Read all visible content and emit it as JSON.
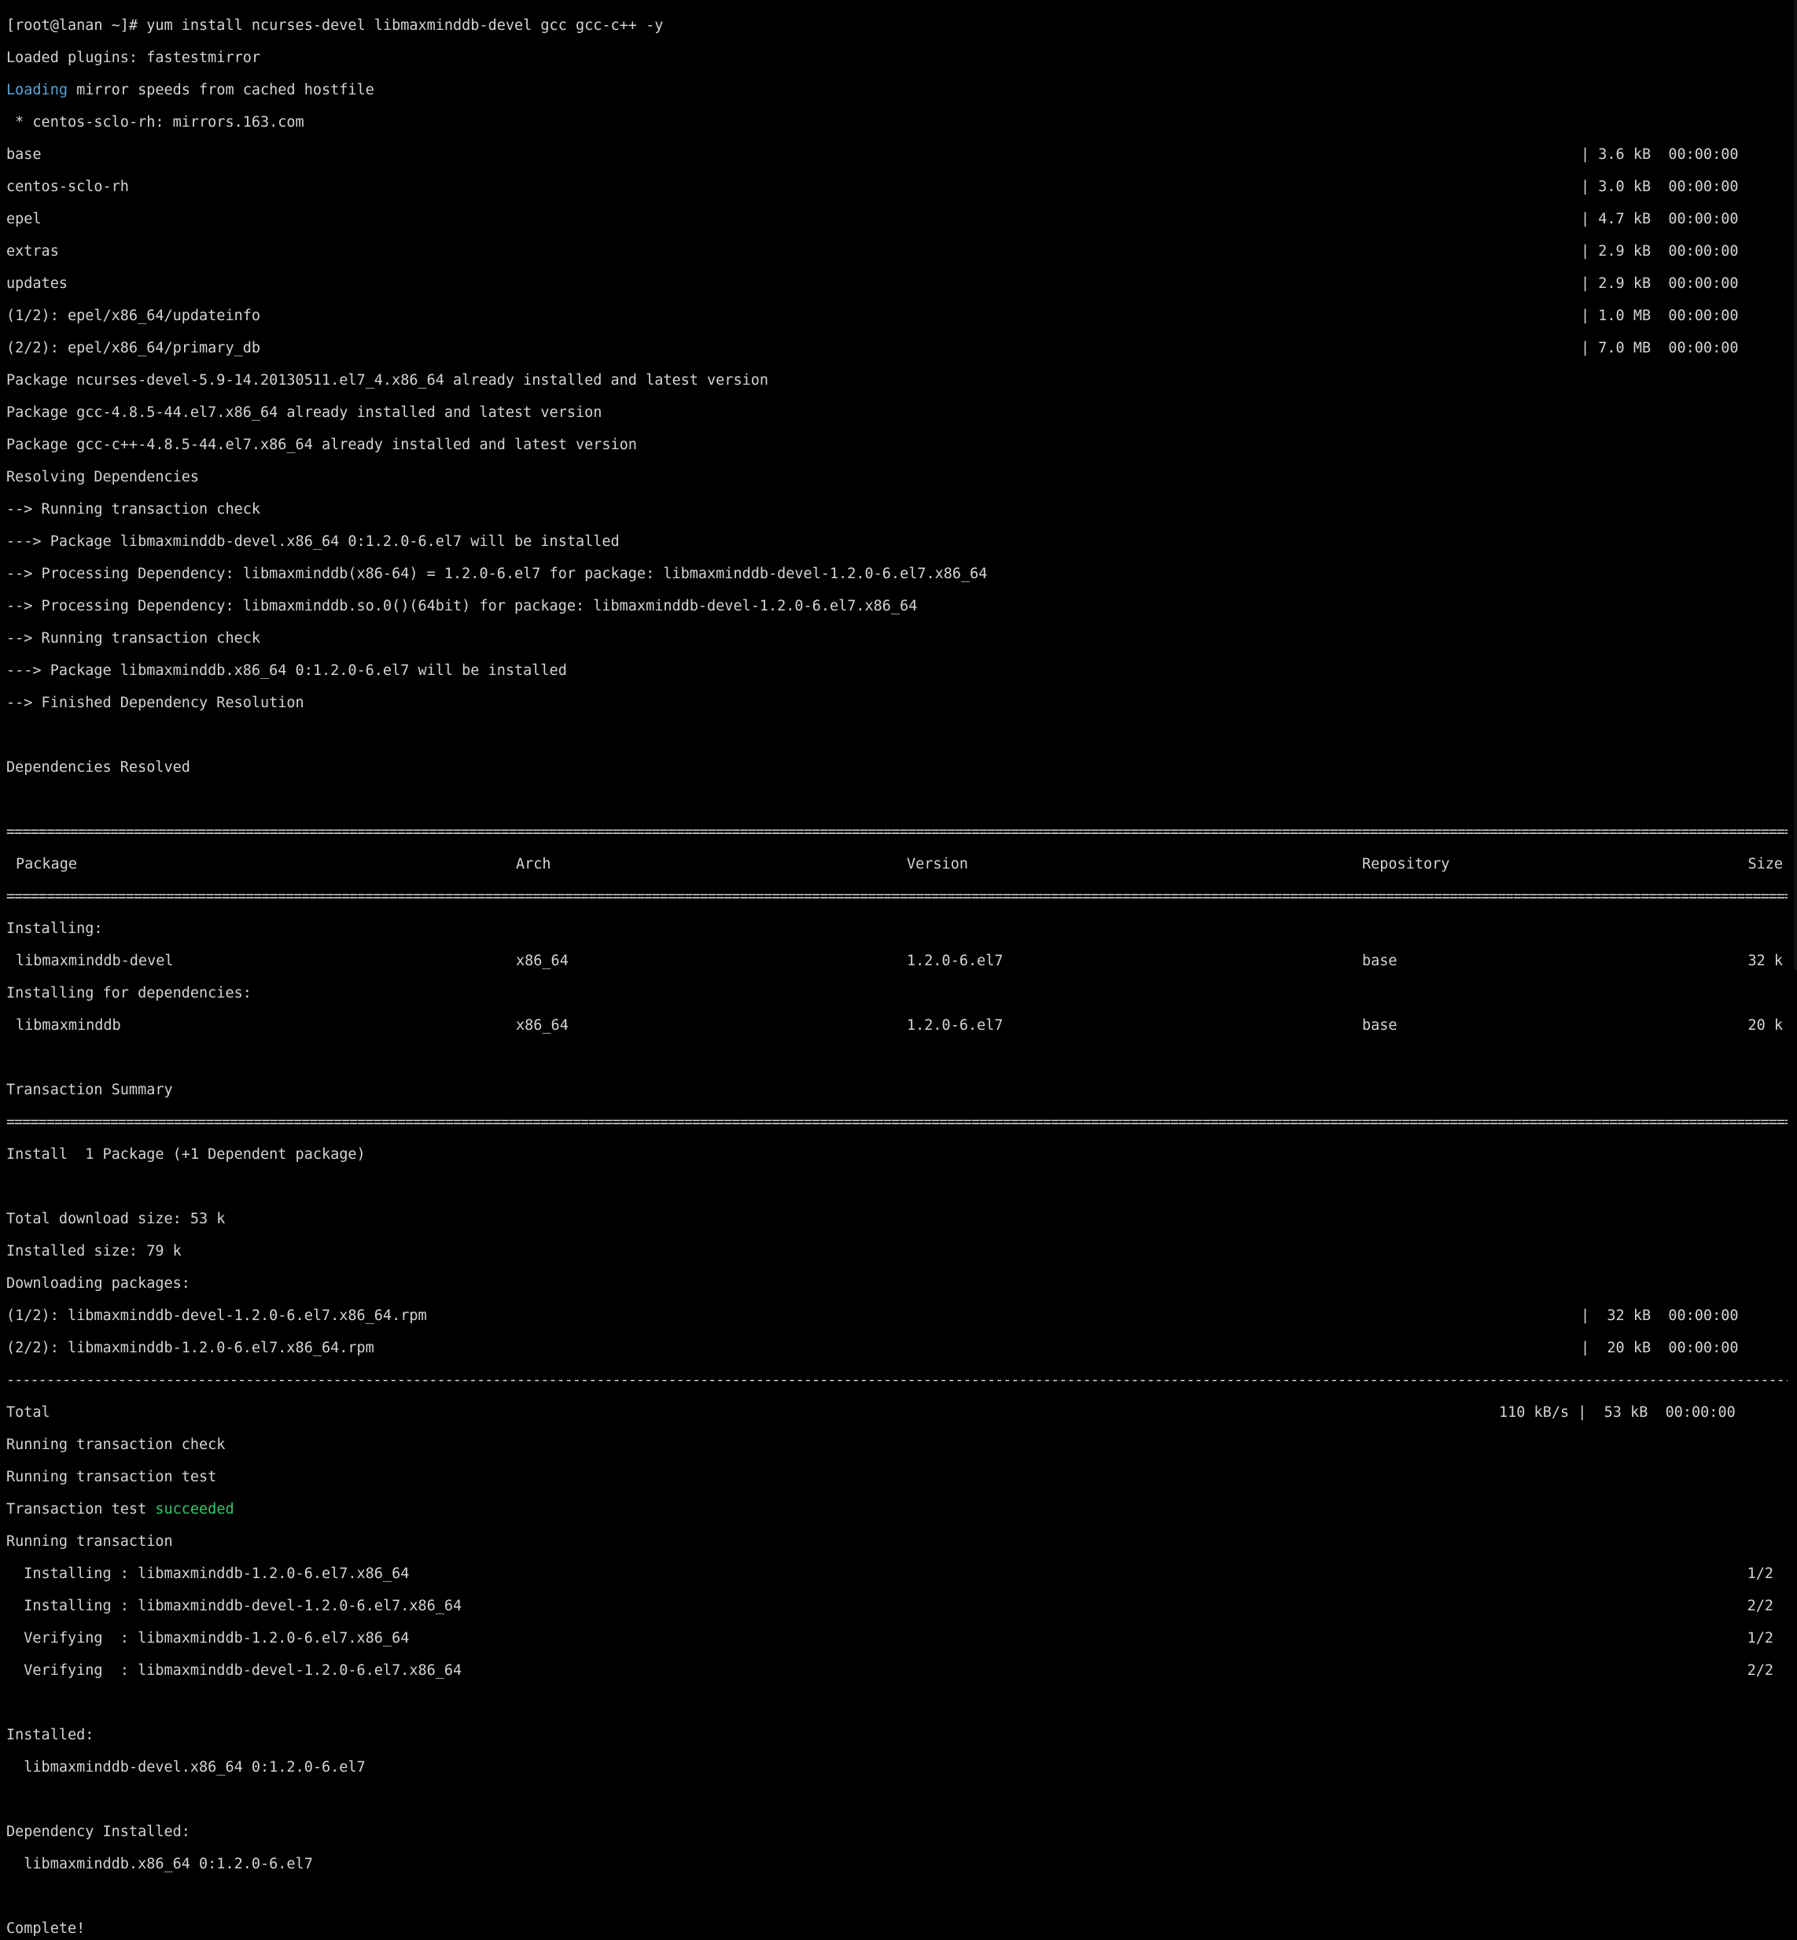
{
  "prompt": "[root@lanan ~]# yum install ncurses-devel libmaxminddb-devel gcc gcc-c++ -y",
  "plugins": "Loaded plugins: fastestmirror",
  "mirror": {
    "word": "Loading",
    "rest": " mirror speeds from cached hostfile"
  },
  "mirror_host": " * centos-sclo-rh: mirrors.163.com",
  "repos": [
    {
      "name": "base",
      "stat": "| 3.6 kB  00:00:00"
    },
    {
      "name": "centos-sclo-rh",
      "stat": "| 3.0 kB  00:00:00"
    },
    {
      "name": "epel",
      "stat": "| 4.7 kB  00:00:00"
    },
    {
      "name": "extras",
      "stat": "| 2.9 kB  00:00:00"
    },
    {
      "name": "updates",
      "stat": "| 2.9 kB  00:00:00"
    },
    {
      "name": "(1/2): epel/x86_64/updateinfo",
      "stat": "| 1.0 MB  00:00:00"
    },
    {
      "name": "(2/2): epel/x86_64/primary_db",
      "stat": "| 7.0 MB  00:00:00"
    }
  ],
  "pre_lines": [
    "Package ncurses-devel-5.9-14.20130511.el7_4.x86_64 already installed and latest version",
    "Package gcc-4.8.5-44.el7.x86_64 already installed and latest version",
    "Package gcc-c++-4.8.5-44.el7.x86_64 already installed and latest version",
    "Resolving Dependencies",
    "--> Running transaction check",
    "---> Package libmaxminddb-devel.x86_64 0:1.2.0-6.el7 will be installed",
    "--> Processing Dependency: libmaxminddb(x86-64) = 1.2.0-6.el7 for package: libmaxminddb-devel-1.2.0-6.el7.x86_64",
    "--> Processing Dependency: libmaxminddb.so.0()(64bit) for package: libmaxminddb-devel-1.2.0-6.el7.x86_64",
    "--> Running transaction check",
    "---> Package libmaxminddb.x86_64 0:1.2.0-6.el7 will be installed",
    "--> Finished Dependency Resolution"
  ],
  "deps_resolved": "Dependencies Resolved",
  "separator_eq": "=============================================================================================================================================================================================================================================================",
  "separator_dash": "---------------------------------------------------------------------------------------------------------------------------------------------------------------------------------------------------------------------------------------------------------------",
  "table_header": {
    "package": "Package",
    "arch": "Arch",
    "version": "Version",
    "repository": "Repository",
    "size": "Size"
  },
  "installing_label": "Installing:",
  "row1": {
    "package": "libmaxminddb-devel",
    "arch": "x86_64",
    "version": "1.2.0-6.el7",
    "repository": "base",
    "size": "32 k"
  },
  "installing_deps_label": "Installing for dependencies:",
  "row2": {
    "package": "libmaxminddb",
    "arch": "x86_64",
    "version": "1.2.0-6.el7",
    "repository": "base",
    "size": "20 k"
  },
  "transaction_summary": "Transaction Summary",
  "install_summary": "Install  1 Package (+1 Dependent package)",
  "total_download": "Total download size: 53 k",
  "installed_size": "Installed size: 79 k",
  "downloading": "Downloading packages:",
  "downloads": [
    {
      "name": "(1/2): libmaxminddb-devel-1.2.0-6.el7.x86_64.rpm",
      "stat": "|  32 kB  00:00:00"
    },
    {
      "name": "(2/2): libmaxminddb-1.2.0-6.el7.x86_64.rpm",
      "stat": "|  20 kB  00:00:00"
    }
  ],
  "total": {
    "label": "Total",
    "stat": "110 kB/s |  53 kB  00:00:00"
  },
  "run_check": "Running transaction check",
  "run_test": "Running transaction test",
  "test_result": {
    "prefix": "Transaction test ",
    "status": "succeeded"
  },
  "running": "Running transaction",
  "steps": [
    {
      "text": "  Installing : libmaxminddb-1.2.0-6.el7.x86_64",
      "count": "1/2"
    },
    {
      "text": "  Installing : libmaxminddb-devel-1.2.0-6.el7.x86_64",
      "count": "2/2"
    },
    {
      "text": "  Verifying  : libmaxminddb-1.2.0-6.el7.x86_64",
      "count": "1/2"
    },
    {
      "text": "  Verifying  : libmaxminddb-devel-1.2.0-6.el7.x86_64",
      "count": "2/2"
    }
  ],
  "installed_label": "Installed:",
  "installed_pkg": "  libmaxminddb-devel.x86_64 0:1.2.0-6.el7",
  "dep_installed_label": "Dependency Installed:",
  "dep_installed_pkg": "  libmaxminddb.x86_64 0:1.2.0-6.el7",
  "complete": "Complete!",
  "colors": {
    "background": "#000000",
    "foreground": "#d4d4d4",
    "loading": "#5aa3d6",
    "succeeded": "#34c46a"
  }
}
